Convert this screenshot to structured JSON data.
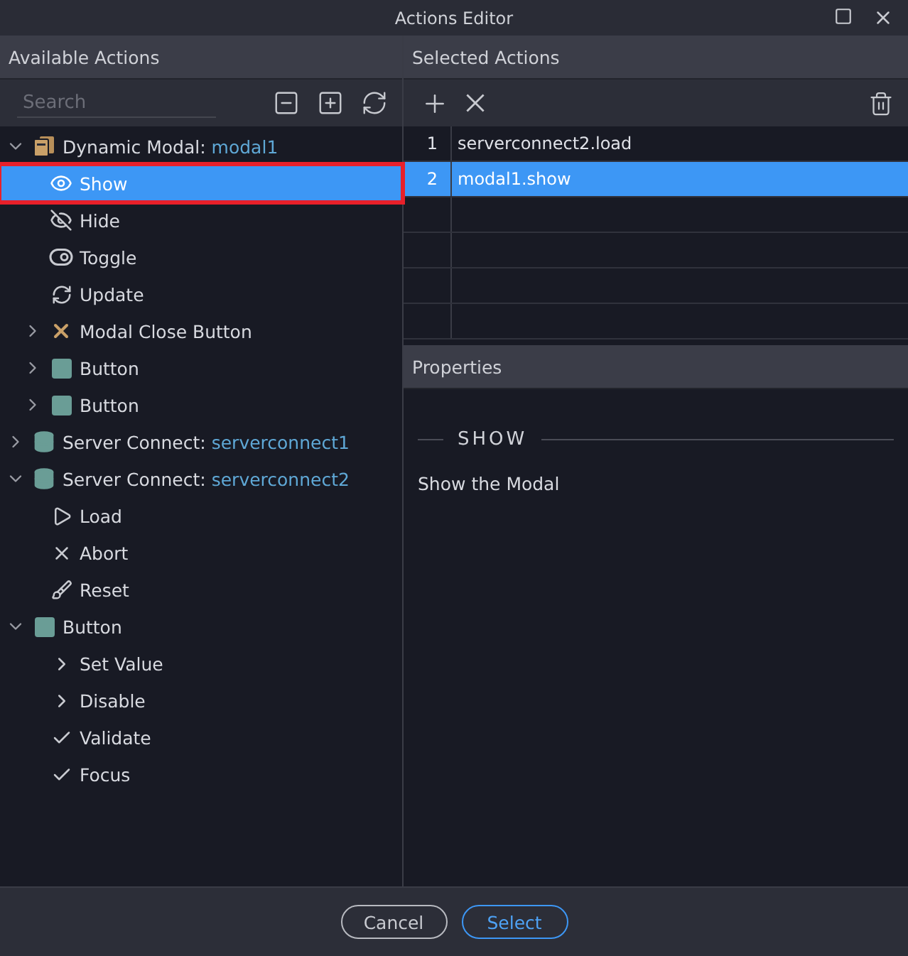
{
  "window": {
    "title": "Actions Editor"
  },
  "available_actions": {
    "title": "Available Actions",
    "search": {
      "placeholder": "Search"
    },
    "tree": [
      {
        "label": "Dynamic Modal:",
        "ref": "modal1",
        "kind": "modal",
        "expanded": true,
        "selected": false,
        "children": [
          {
            "label": "Show",
            "kind": "eye",
            "selected": true,
            "highlighted": true
          },
          {
            "label": "Hide",
            "kind": "eye-off",
            "selected": false,
            "highlighted": false
          },
          {
            "label": "Toggle",
            "kind": "toggle",
            "selected": false,
            "highlighted": false
          },
          {
            "label": "Update",
            "kind": "refresh",
            "selected": false,
            "highlighted": false
          },
          {
            "label": "Modal Close Button",
            "kind": "close-x",
            "expanded": false,
            "selected": false,
            "highlighted": false
          },
          {
            "label": "Button",
            "kind": "square",
            "expanded": false,
            "selected": false,
            "highlighted": false
          },
          {
            "label": "Button",
            "kind": "square",
            "expanded": false,
            "selected": false,
            "highlighted": false
          }
        ]
      },
      {
        "label": "Server Connect:",
        "ref": "serverconnect1",
        "kind": "database",
        "expanded": false,
        "selected": false
      },
      {
        "label": "Server Connect:",
        "ref": "serverconnect2",
        "kind": "database",
        "expanded": true,
        "selected": false,
        "children": [
          {
            "label": "Load",
            "kind": "play",
            "selected": false,
            "highlighted": false
          },
          {
            "label": "Abort",
            "kind": "x",
            "selected": false,
            "highlighted": false
          },
          {
            "label": "Reset",
            "kind": "brush",
            "selected": false,
            "highlighted": false
          }
        ]
      },
      {
        "label": "Button",
        "kind": "square",
        "expanded": true,
        "selected": false,
        "children": [
          {
            "label": "Set Value",
            "kind": "chevron",
            "selected": false,
            "highlighted": false
          },
          {
            "label": "Disable",
            "kind": "chevron",
            "selected": false,
            "highlighted": false
          },
          {
            "label": "Validate",
            "kind": "check",
            "selected": false,
            "highlighted": false
          },
          {
            "label": "Focus",
            "kind": "check",
            "selected": false,
            "highlighted": false
          }
        ]
      }
    ]
  },
  "selected_actions": {
    "title": "Selected Actions",
    "rows": [
      {
        "number": "1",
        "action": "serverconnect2.load",
        "selected": false
      },
      {
        "number": "2",
        "action": "modal1.show",
        "selected": true
      }
    ]
  },
  "properties": {
    "title": "Properties",
    "section": "SHOW",
    "description": "Show the Modal"
  },
  "buttons": [
    {
      "label": "Cancel",
      "kind": "secondary"
    },
    {
      "label": "Select",
      "kind": "primary"
    }
  ]
}
